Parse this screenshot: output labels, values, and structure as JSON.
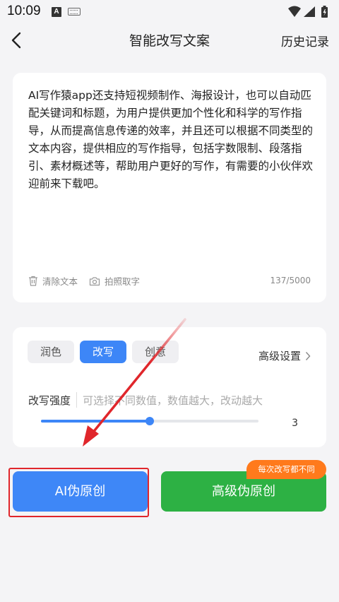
{
  "status_bar": {
    "time": "10:09",
    "notification_letter": "A"
  },
  "header": {
    "title": "智能改写文案",
    "history": "历史记录"
  },
  "text_card": {
    "content": "AI写作猿app还支持短视频制作、海报设计，也可以自动匹配关键词和标题，为用户提供更加个性化和科学的写作指导，从而提高信息传递的效率，并且还可以根据不同类型的文本内容，提供相应的写作指导，包括字数限制、段落指引、素材概述等，帮助用户更好的写作，有需要的小伙伴欢迎前来下载吧。",
    "clear_label": "清除文本",
    "photo_label": "拍照取字",
    "counter": "137/5000"
  },
  "settings": {
    "tabs": [
      {
        "label": "润色",
        "active": false
      },
      {
        "label": "改写",
        "active": true
      },
      {
        "label": "创意",
        "active": false
      }
    ],
    "advanced_label": "高级设置",
    "strength_label": "改写强度",
    "strength_hint": "可选择不同数值，数值越大，改动越大",
    "strength_value": "3",
    "strength_fraction": 0.5
  },
  "buttons": {
    "ai_label": "AI伪原创",
    "advanced_label": "高级伪原创",
    "badge": "每次改写都不同"
  },
  "colors": {
    "accent_blue": "#3e87f7",
    "green": "#2db144",
    "orange": "#ff7a1c",
    "annotation_red": "#e0262b"
  },
  "icons": [
    "back-icon",
    "wifi-icon",
    "signal-icon",
    "battery-icon",
    "trash-icon",
    "camera-icon",
    "chevron-right-icon",
    "keyboard-icon"
  ]
}
